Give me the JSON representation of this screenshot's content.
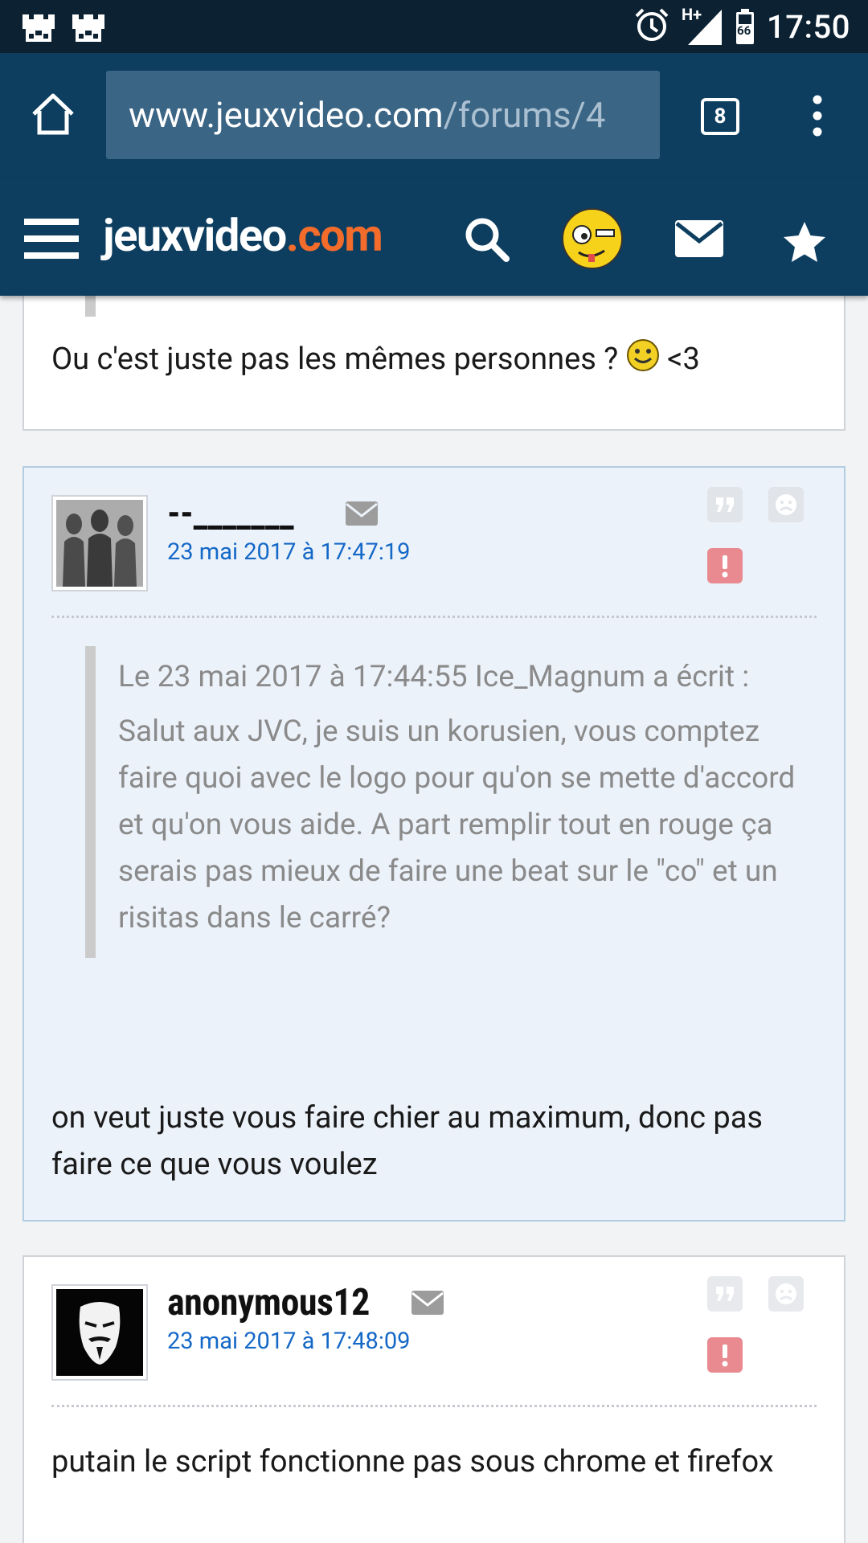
{
  "status_bar": {
    "time": "17:50",
    "network": "H+",
    "battery": "66"
  },
  "browser": {
    "url_host": "www.jeuxvideo.com",
    "url_path": "/forums/4",
    "tab_count": "8"
  },
  "site": {
    "logo_main": "jeuxvideo",
    "logo_suffix": ".com"
  },
  "posts": [
    {
      "text": "Ou c'est juste pas les mêmes personnes ?",
      "text_suffix": "<3"
    },
    {
      "author": "--_______",
      "date": "23 mai 2017 à 17:47:19",
      "quote_header": "Le 23 mai 2017 à 17:44:55 Ice_Magnum a écrit :",
      "quote_body": "Salut aux JVC, je suis un korusien, vous comptez faire quoi avec le logo pour qu'on se mette d'accord et qu'on vous aide. A part remplir tout en rouge ça serais pas mieux de faire une beat sur le \"co\" et un risitas dans le carré?",
      "text": "on veut juste vous faire chier au maximum, donc pas faire ce que vous voulez"
    },
    {
      "author": "anonymous12",
      "date": "23 mai 2017 à 17:48:09",
      "text": "putain le script fonctionne pas sous chrome et firefox"
    }
  ],
  "colors": {
    "header_bg": "#0d3e60",
    "status_bg": "#0c2233",
    "logo_accent": "#f46c2b",
    "date_link": "#1468c7",
    "alert_red": "#e88a8f",
    "highlight_bg": "#ecf2fa"
  }
}
